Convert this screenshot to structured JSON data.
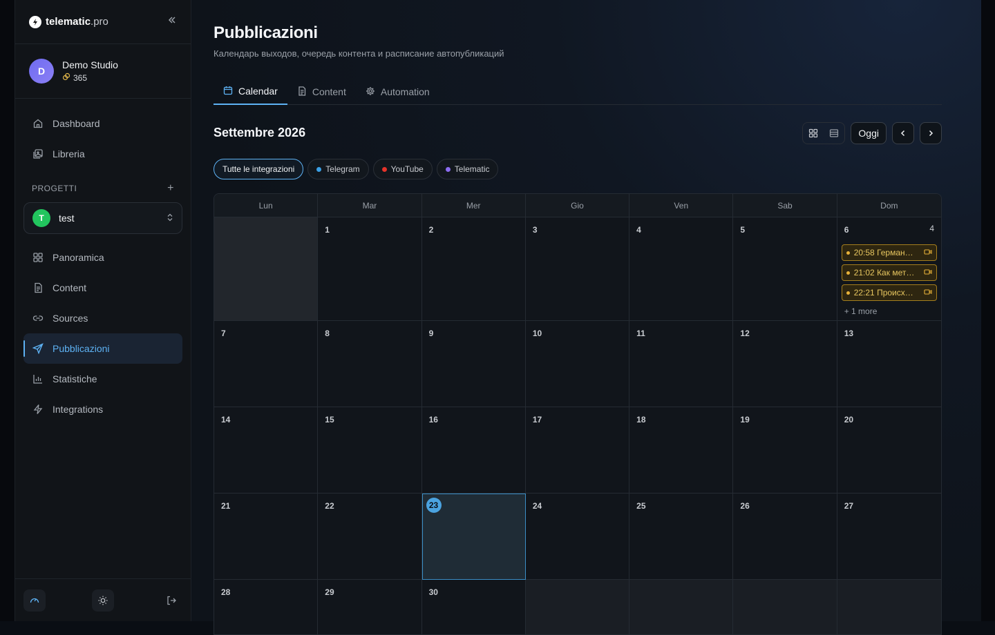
{
  "brand": {
    "name": "telematic",
    "suffix": ".pro"
  },
  "workspace": {
    "initial": "D",
    "name": "Demo Studio",
    "credits": "365"
  },
  "nav": {
    "dashboard": "Dashboard",
    "library": "Libreria"
  },
  "projects": {
    "section_label": "PROGETTI",
    "selected": {
      "initial": "T",
      "name": "test"
    },
    "items": {
      "overview": "Panoramica",
      "content": "Content",
      "sources": "Sources",
      "publications": "Pubblicazioni",
      "stats": "Statistiche",
      "integrations": "Integrations"
    }
  },
  "page": {
    "title": "Pubblicazioni",
    "subtitle": "Календарь выходов, очередь контента и расписание автопубликаций"
  },
  "tabs": {
    "calendar": "Calendar",
    "content": "Content",
    "automation": "Automation"
  },
  "calendar": {
    "month_label": "Settembre 2026",
    "today_button": "Oggi",
    "filters": {
      "all": "Tutte le integrazioni",
      "telegram": "Telegram",
      "youtube": "YouTube",
      "telematic": "Telematic"
    },
    "filter_colors": {
      "telegram": "#3ba0e6",
      "youtube": "#e5332a",
      "telematic": "#8b6cf0"
    },
    "weekdays": [
      "Lun",
      "Mar",
      "Mer",
      "Gio",
      "Ven",
      "Sab",
      "Dom"
    ],
    "day6": {
      "count": "4",
      "events": [
        {
          "text": "20:58 Герман…"
        },
        {
          "text": "21:02 Как мет…"
        },
        {
          "text": "22:21 Происх…"
        }
      ],
      "more": "+ 1 more"
    },
    "days": {
      "d1": "1",
      "d2": "2",
      "d3": "3",
      "d4": "4",
      "d5": "5",
      "d6": "6",
      "d7": "7",
      "d8": "8",
      "d9": "9",
      "d10": "10",
      "d11": "11",
      "d12": "12",
      "d13": "13",
      "d14": "14",
      "d15": "15",
      "d16": "16",
      "d17": "17",
      "d18": "18",
      "d19": "19",
      "d20": "20",
      "d21": "21",
      "d22": "22",
      "d23": "23",
      "d24": "24",
      "d25": "25",
      "d26": "26",
      "d27": "27",
      "d28": "28",
      "d29": "29",
      "d30": "30"
    }
  }
}
